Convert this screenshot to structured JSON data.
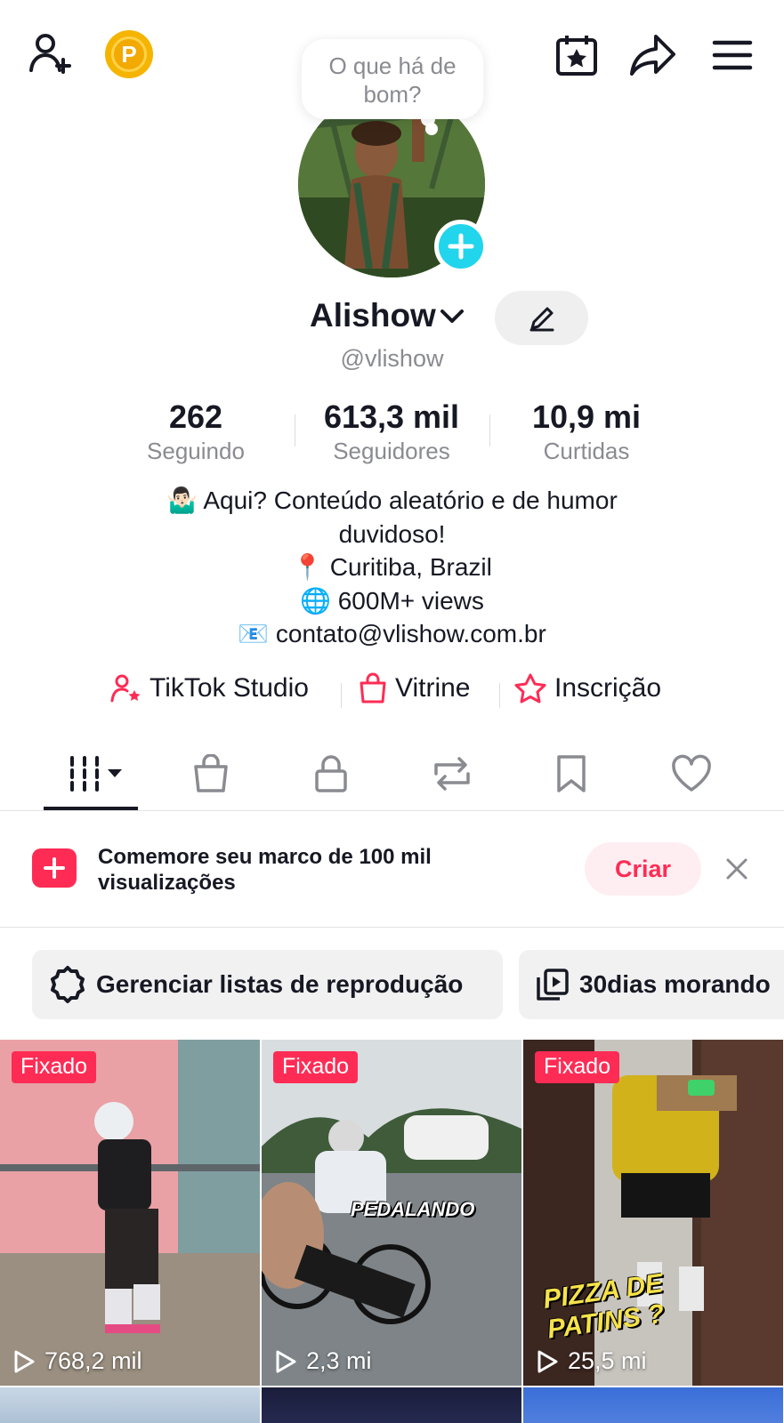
{
  "header": {
    "coin_letter": "P",
    "bubble_text": "O que há de bom?"
  },
  "profile": {
    "display_name": "Alishow",
    "handle": "@vlishow"
  },
  "stats": [
    {
      "value": "262",
      "label": "Seguindo"
    },
    {
      "value": "613,3 mil",
      "label": "Seguidores"
    },
    {
      "value": "10,9 mi",
      "label": "Curtidas"
    }
  ],
  "bio": {
    "line1": "🤷🏻‍♂️ Aqui? Conteúdo aleatório e de humor",
    "line2": "duvidoso!",
    "line3": "📍 Curitiba, Brazil",
    "line4": "🌐 600M+ views",
    "line5": "📧 contato@vlishow.com.br"
  },
  "links": {
    "studio": "TikTok Studio",
    "vitrine": "Vitrine",
    "inscricao": "Inscrição"
  },
  "banner": {
    "text": "Comemore seu marco de 100 mil visualizações",
    "button": "Criar"
  },
  "chips": {
    "manage": "Gerenciar listas de reprodução",
    "playlist": "30dias morando"
  },
  "colors": {
    "accent": "#fe2c55",
    "teal": "#20d5ec",
    "gold": "#f5b400"
  },
  "videos": [
    {
      "badge": "Fixado",
      "views": "768,2 mil",
      "overlay": ""
    },
    {
      "badge": "Fixado",
      "views": "2,3 mi",
      "overlay": "PEDALANDO"
    },
    {
      "badge": "Fixado",
      "views": "25,5 mi",
      "overlay": "PIZZA DE PATINS ?"
    }
  ]
}
